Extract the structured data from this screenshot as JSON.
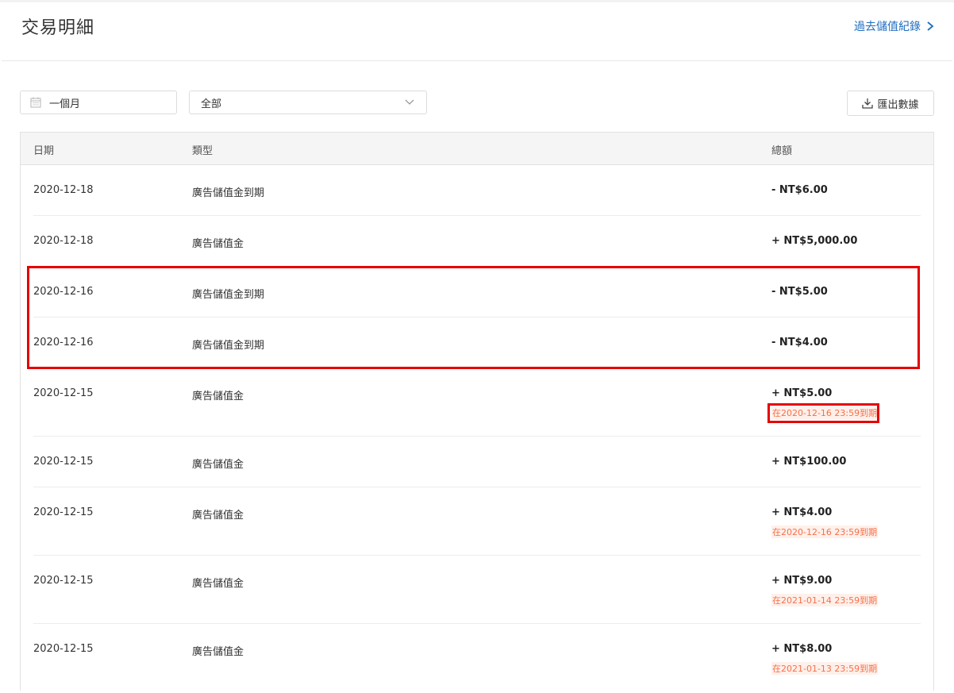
{
  "header": {
    "title": "交易明細",
    "history_link": "過去儲值紀錄"
  },
  "filters": {
    "date_range": "一個月",
    "type_selected": "全部",
    "export_label": "匯出數據"
  },
  "table": {
    "columns": {
      "date": "日期",
      "type": "類型",
      "amount": "總額"
    },
    "rows": [
      {
        "date": "2020-12-18",
        "type": "廣告儲值金到期",
        "amount": "- NT$6.00",
        "expiry": ""
      },
      {
        "date": "2020-12-18",
        "type": "廣告儲值金",
        "amount": "+ NT$5,000.00",
        "expiry": ""
      },
      {
        "date": "2020-12-16",
        "type": "廣告儲值金到期",
        "amount": "- NT$5.00",
        "expiry": ""
      },
      {
        "date": "2020-12-16",
        "type": "廣告儲值金到期",
        "amount": "- NT$4.00",
        "expiry": ""
      },
      {
        "date": "2020-12-15",
        "type": "廣告儲值金",
        "amount": "+ NT$5.00",
        "expiry": "在2020-12-16 23:59到期"
      },
      {
        "date": "2020-12-15",
        "type": "廣告儲值金",
        "amount": "+ NT$100.00",
        "expiry": ""
      },
      {
        "date": "2020-12-15",
        "type": "廣告儲值金",
        "amount": "+ NT$4.00",
        "expiry": "在2020-12-16 23:59到期"
      },
      {
        "date": "2020-12-15",
        "type": "廣告儲值金",
        "amount": "+ NT$9.00",
        "expiry": "在2021-01-14 23:59到期"
      },
      {
        "date": "2020-12-15",
        "type": "廣告儲值金",
        "amount": "+ NT$8.00",
        "expiry": "在2021-01-13 23:59到期"
      }
    ]
  },
  "colors": {
    "link": "#1f6dc2",
    "expiry_text": "#f5704a",
    "expiry_bg": "#fff0ea",
    "highlight": "#e60000"
  },
  "icons": {
    "date_filter": "calendar-icon",
    "type_select": "chevron-down-icon",
    "export": "download-icon",
    "history_link": "chevron-right-icon"
  }
}
